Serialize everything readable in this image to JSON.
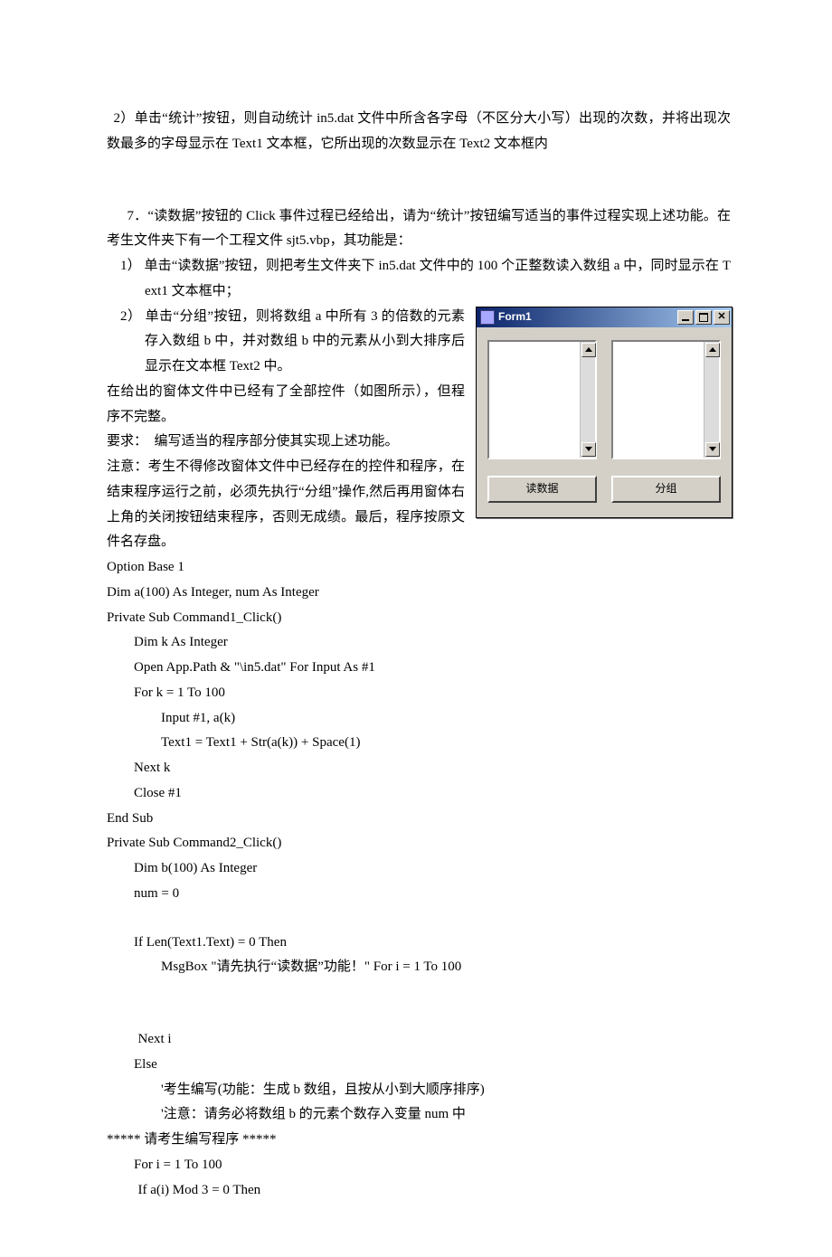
{
  "intro_para": "2）单击“统计”按钮，则自动统计 in5.dat 文件中所含各字母（不区分大小写）出现的次数，并将出现次数最多的字母显示在 Text1 文本框，它所出现的次数显示在 Text2 文本框内",
  "para7_lead": "7．“读数据”按钮的 Click 事件过程已经给出，请为“统计”按钮编写适当的事件过程实现上述功能。在考生文件夹下有一个工程文件 sjt5.vbp，其功能是：",
  "li1": "1） 单击“读数据”按钮，则把考生文件夹下 in5.dat 文件中的 100 个正整数读入数组 a 中，同时显示在 Text1 文本框中；",
  "li2a": "2） 单击“分组”按钮，则将数组 a 中所有 3 的倍数的元素存入数组 b 中，并对数组 b 中的元素从小到大排序后显示在文本框 Text2 中。",
  "p_controls": "在给出的窗体文件中已经有了全部控件（如图所示），但程序不完整。",
  "p_req": "要求：　编写适当的程序部分使其实现上述功能。",
  "p_note": "注意：考生不得修改窗体文件中已经存在的控件和程序，在结束程序运行之前，必须先执行“分组”操作,然后再用窗体右上角的关闭按钮结束程序，否则无成绩。最后，程序按原文件名存盘。",
  "code": {
    "c01": "Option Base 1",
    "c02": "Dim a(100) As Integer, num As Integer",
    "c03": "Private Sub Command1_Click()",
    "c04": "Dim k As Integer",
    "c05": "Open App.Path & \"\\in5.dat\" For Input As #1",
    "c06": "For k = 1 To 100",
    "c07": "Input #1, a(k)",
    "c08": "Text1 = Text1 + Str(a(k)) + Space(1)",
    "c09": "Next k",
    "c10": "Close #1",
    "c11": "End Sub",
    "c12": "Private Sub Command2_Click()",
    "c13": "Dim b(100) As Integer",
    "c14": "num = 0",
    "c15": "If Len(Text1.Text) = 0 Then",
    "c16": "MsgBox \"请先执行“读数据”功能！\" For i = 1 To 100",
    "c17": "Next i",
    "c18": "Else",
    "c19": "'考生编写(功能：生成 b 数组，且按从小到大顺序排序)",
    "c20": "'注意：请务必将数组 b 的元素个数存入变量 num 中",
    "c21": "*****  请考生编写程序  *****",
    "c22": "For i = 1 To 100",
    "c23": "If a(i) Mod 3 = 0 Then"
  },
  "form": {
    "title": "Form1",
    "btn_read": "读数据",
    "btn_group": "分组"
  }
}
